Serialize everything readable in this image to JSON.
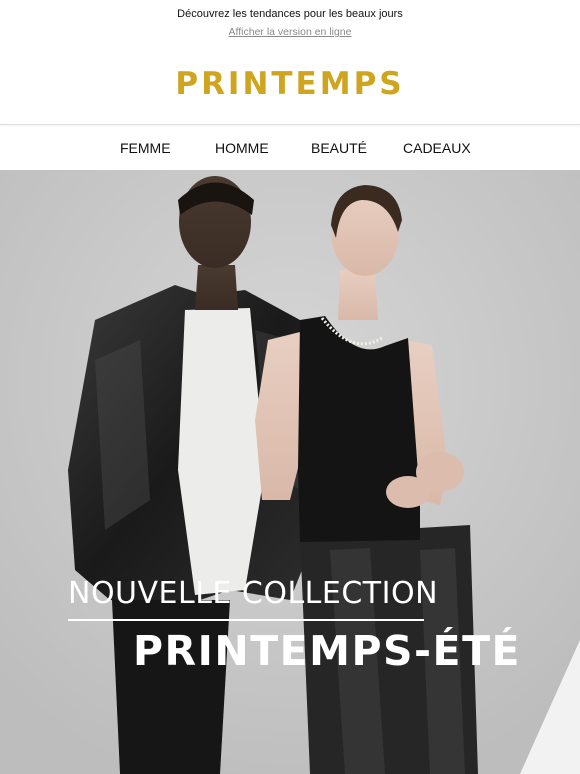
{
  "preheader": {
    "tagline": "Découvrez les tendances pour les beaux jours",
    "view_online": "Afficher la version en ligne"
  },
  "brand": {
    "logo_text": "PRINTEMPS",
    "color": "#cfa41f"
  },
  "nav": {
    "items": [
      {
        "label": "FEMME"
      },
      {
        "label": "HOMME"
      },
      {
        "label": "BEAUTÉ"
      },
      {
        "label": "CADEAUX"
      }
    ]
  },
  "hero": {
    "headline": "NOUVELLE COLLECTION",
    "subheadline": "PRINTEMPS-ÉTÉ",
    "text_color": "#ffffff"
  }
}
